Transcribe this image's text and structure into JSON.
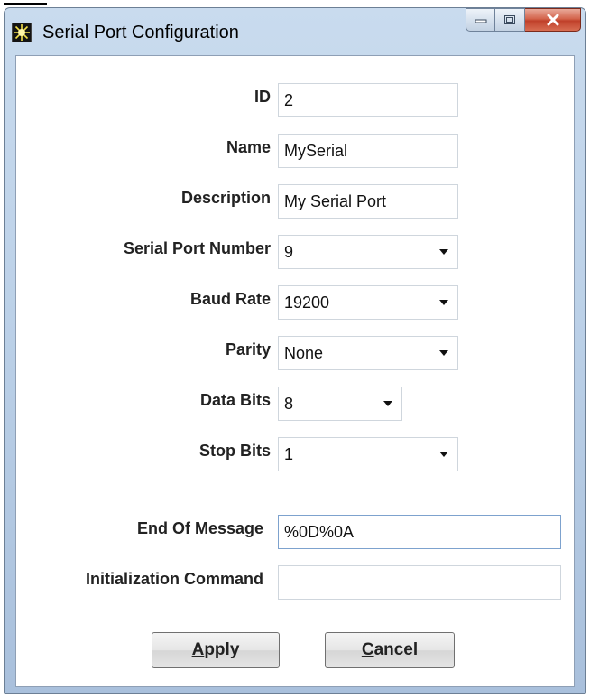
{
  "window": {
    "title": "Serial Port Configuration"
  },
  "form": {
    "id": {
      "label": "ID",
      "value": "2"
    },
    "name": {
      "label": "Name",
      "value": "MySerial"
    },
    "description": {
      "label": "Description",
      "value": "My Serial Port"
    },
    "serial_port_number": {
      "label": "Serial Port Number",
      "value": "9"
    },
    "baud_rate": {
      "label": "Baud Rate",
      "value": "19200"
    },
    "parity": {
      "label": "Parity",
      "value": "None"
    },
    "data_bits": {
      "label": "Data Bits",
      "value": "8"
    },
    "stop_bits": {
      "label": "Stop Bits",
      "value": "1"
    },
    "end_of_message": {
      "label": "End Of Message",
      "value": "%0D%0A"
    },
    "initialization_command": {
      "label": "Initialization Command",
      "value": ""
    }
  },
  "buttons": {
    "apply": {
      "mnemonic": "A",
      "rest": "pply"
    },
    "cancel": {
      "mnemonic": "C",
      "rest": "ancel"
    }
  },
  "icons": {
    "app": "sun-burst-icon",
    "minimize": "minimize-icon",
    "maximize": "maximize-icon",
    "close": "close-icon",
    "dropdown": "chevron-down-icon"
  },
  "colors": {
    "titlebar": "#bcd1e8",
    "close_button": "#c9452f"
  }
}
